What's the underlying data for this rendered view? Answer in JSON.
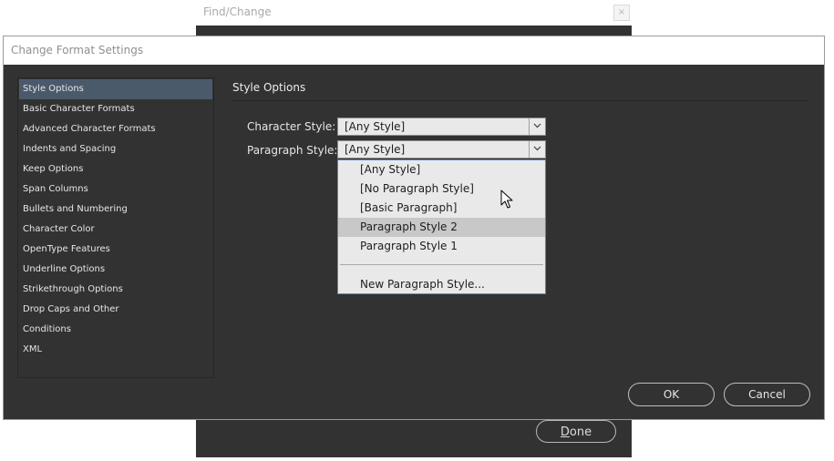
{
  "find_change": {
    "title": "Find/Change",
    "close_glyph": "×",
    "done_first": "D",
    "done_rest": "one"
  },
  "dialog": {
    "title": "Change Format Settings",
    "categories": [
      "Style Options",
      "Basic Character Formats",
      "Advanced Character Formats",
      "Indents and Spacing",
      "Keep Options",
      "Span Columns",
      "Bullets and Numbering",
      "Character Color",
      "OpenType Features",
      "Underline Options",
      "Strikethrough Options",
      "Drop Caps and Other",
      "Conditions",
      "XML"
    ],
    "selected_category": "Style Options",
    "panel_heading": "Style Options",
    "character_style": {
      "label": "Character Style:",
      "value": "[Any Style]"
    },
    "paragraph_style": {
      "label": "Paragraph Style:",
      "value": "[Any Style]"
    },
    "dropdown_items": [
      "[Any Style]",
      "[No Paragraph Style]",
      "[Basic Paragraph]",
      "Paragraph Style 2",
      "Paragraph Style 1"
    ],
    "dropdown_hovered": "Paragraph Style 2",
    "dropdown_new": "New Paragraph Style...",
    "ok_label": "OK",
    "cancel_label": "Cancel"
  },
  "icons": {
    "dropdown_arrow": "chevron-down-icon",
    "cursor": "mouse-pointer-icon"
  }
}
